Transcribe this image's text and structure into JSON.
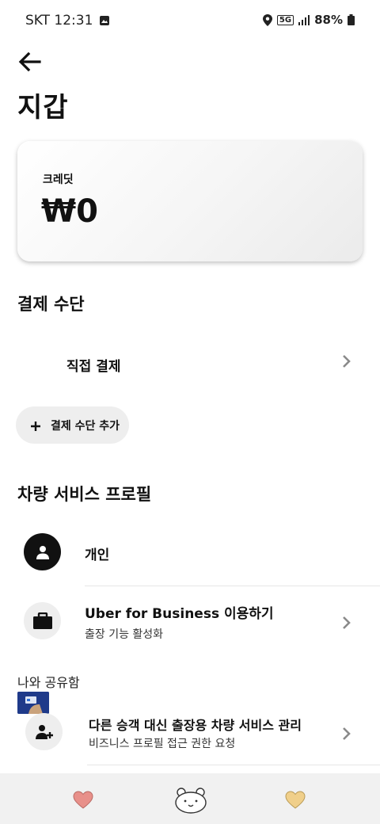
{
  "status_bar": {
    "carrier_time": "SKT 12:31",
    "network": "5G",
    "battery": "88%"
  },
  "header": {
    "title": "지갑"
  },
  "credit": {
    "label": "크레딧",
    "amount": "₩0"
  },
  "payment": {
    "section_title": "결제 수단",
    "method_label": "직접 결제",
    "add_label": "결제 수단 추가"
  },
  "profiles": {
    "section_title": "차량 서비스 프로필",
    "personal_label": "개인",
    "business_title": "Uber for Business 이용하기",
    "business_sub": "출장 기능 활성화"
  },
  "shared": {
    "section_title": "나와 공유함",
    "manage_title": "다른 승객 대신 출장용 차량 서비스 관리",
    "manage_sub": "비즈니스 프로필 접근 권한 요청"
  },
  "icons": {
    "back": "arrow-left-icon",
    "chevron": "chevron-right-icon",
    "person": "person-icon",
    "briefcase": "briefcase-icon",
    "add_person": "add-person-icon"
  },
  "colors": {
    "payment_icon": "#1f3a8a",
    "heart_left": "#e8908a",
    "heart_right": "#f0cf8a"
  }
}
